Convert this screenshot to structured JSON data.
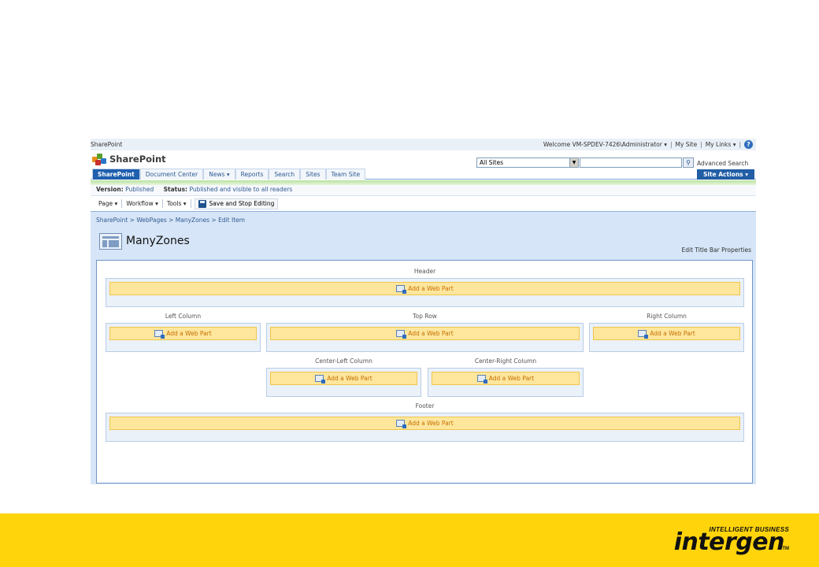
{
  "global": {
    "site_name": "SharePoint",
    "welcome": "Welcome VM-SPDEV-7426\\Administrator ▾",
    "my_site": "My Site",
    "my_links": "My Links ▾",
    "help": "?"
  },
  "header": {
    "site_title": "SharePoint",
    "search_scope": "All Sites",
    "advanced_search": "Advanced Search"
  },
  "tabs": [
    {
      "label": "SharePoint",
      "active": true
    },
    {
      "label": "Document Center",
      "active": false
    },
    {
      "label": "News ▾",
      "active": false
    },
    {
      "label": "Reports",
      "active": false
    },
    {
      "label": "Search",
      "active": false
    },
    {
      "label": "Sites",
      "active": false
    },
    {
      "label": "Team Site",
      "active": false
    }
  ],
  "site_actions": "Site Actions ▾",
  "status": {
    "version_label": "Version:",
    "version_value": "Published",
    "status_label": "Status:",
    "status_value": "Published and visible to all readers"
  },
  "toolbar": {
    "page": "Page ▾",
    "workflow": "Workflow ▾",
    "tools": "Tools ▾",
    "save_stop": "Save and Stop Editing"
  },
  "page": {
    "breadcrumb": "SharePoint > WebPages > ManyZones > Edit Item",
    "title": "ManyZones",
    "edit_title_bar": "Edit Title Bar Properties"
  },
  "zones": {
    "header": "Header",
    "left_column": "Left Column",
    "top_row": "Top Row",
    "right_column": "Right Column",
    "center_left": "Center-Left Column",
    "center_right": "Center-Right Column",
    "footer": "Footer",
    "add_label": "Add a Web Part"
  },
  "brand": {
    "tagline": "INTELLIGENT BUSINESS",
    "logo": "intergen",
    "tm": "TM"
  },
  "colors": {
    "tab_active": "#1e5fae",
    "add_bar": "#ffe69d",
    "brand_yellow": "#ffd40a"
  }
}
